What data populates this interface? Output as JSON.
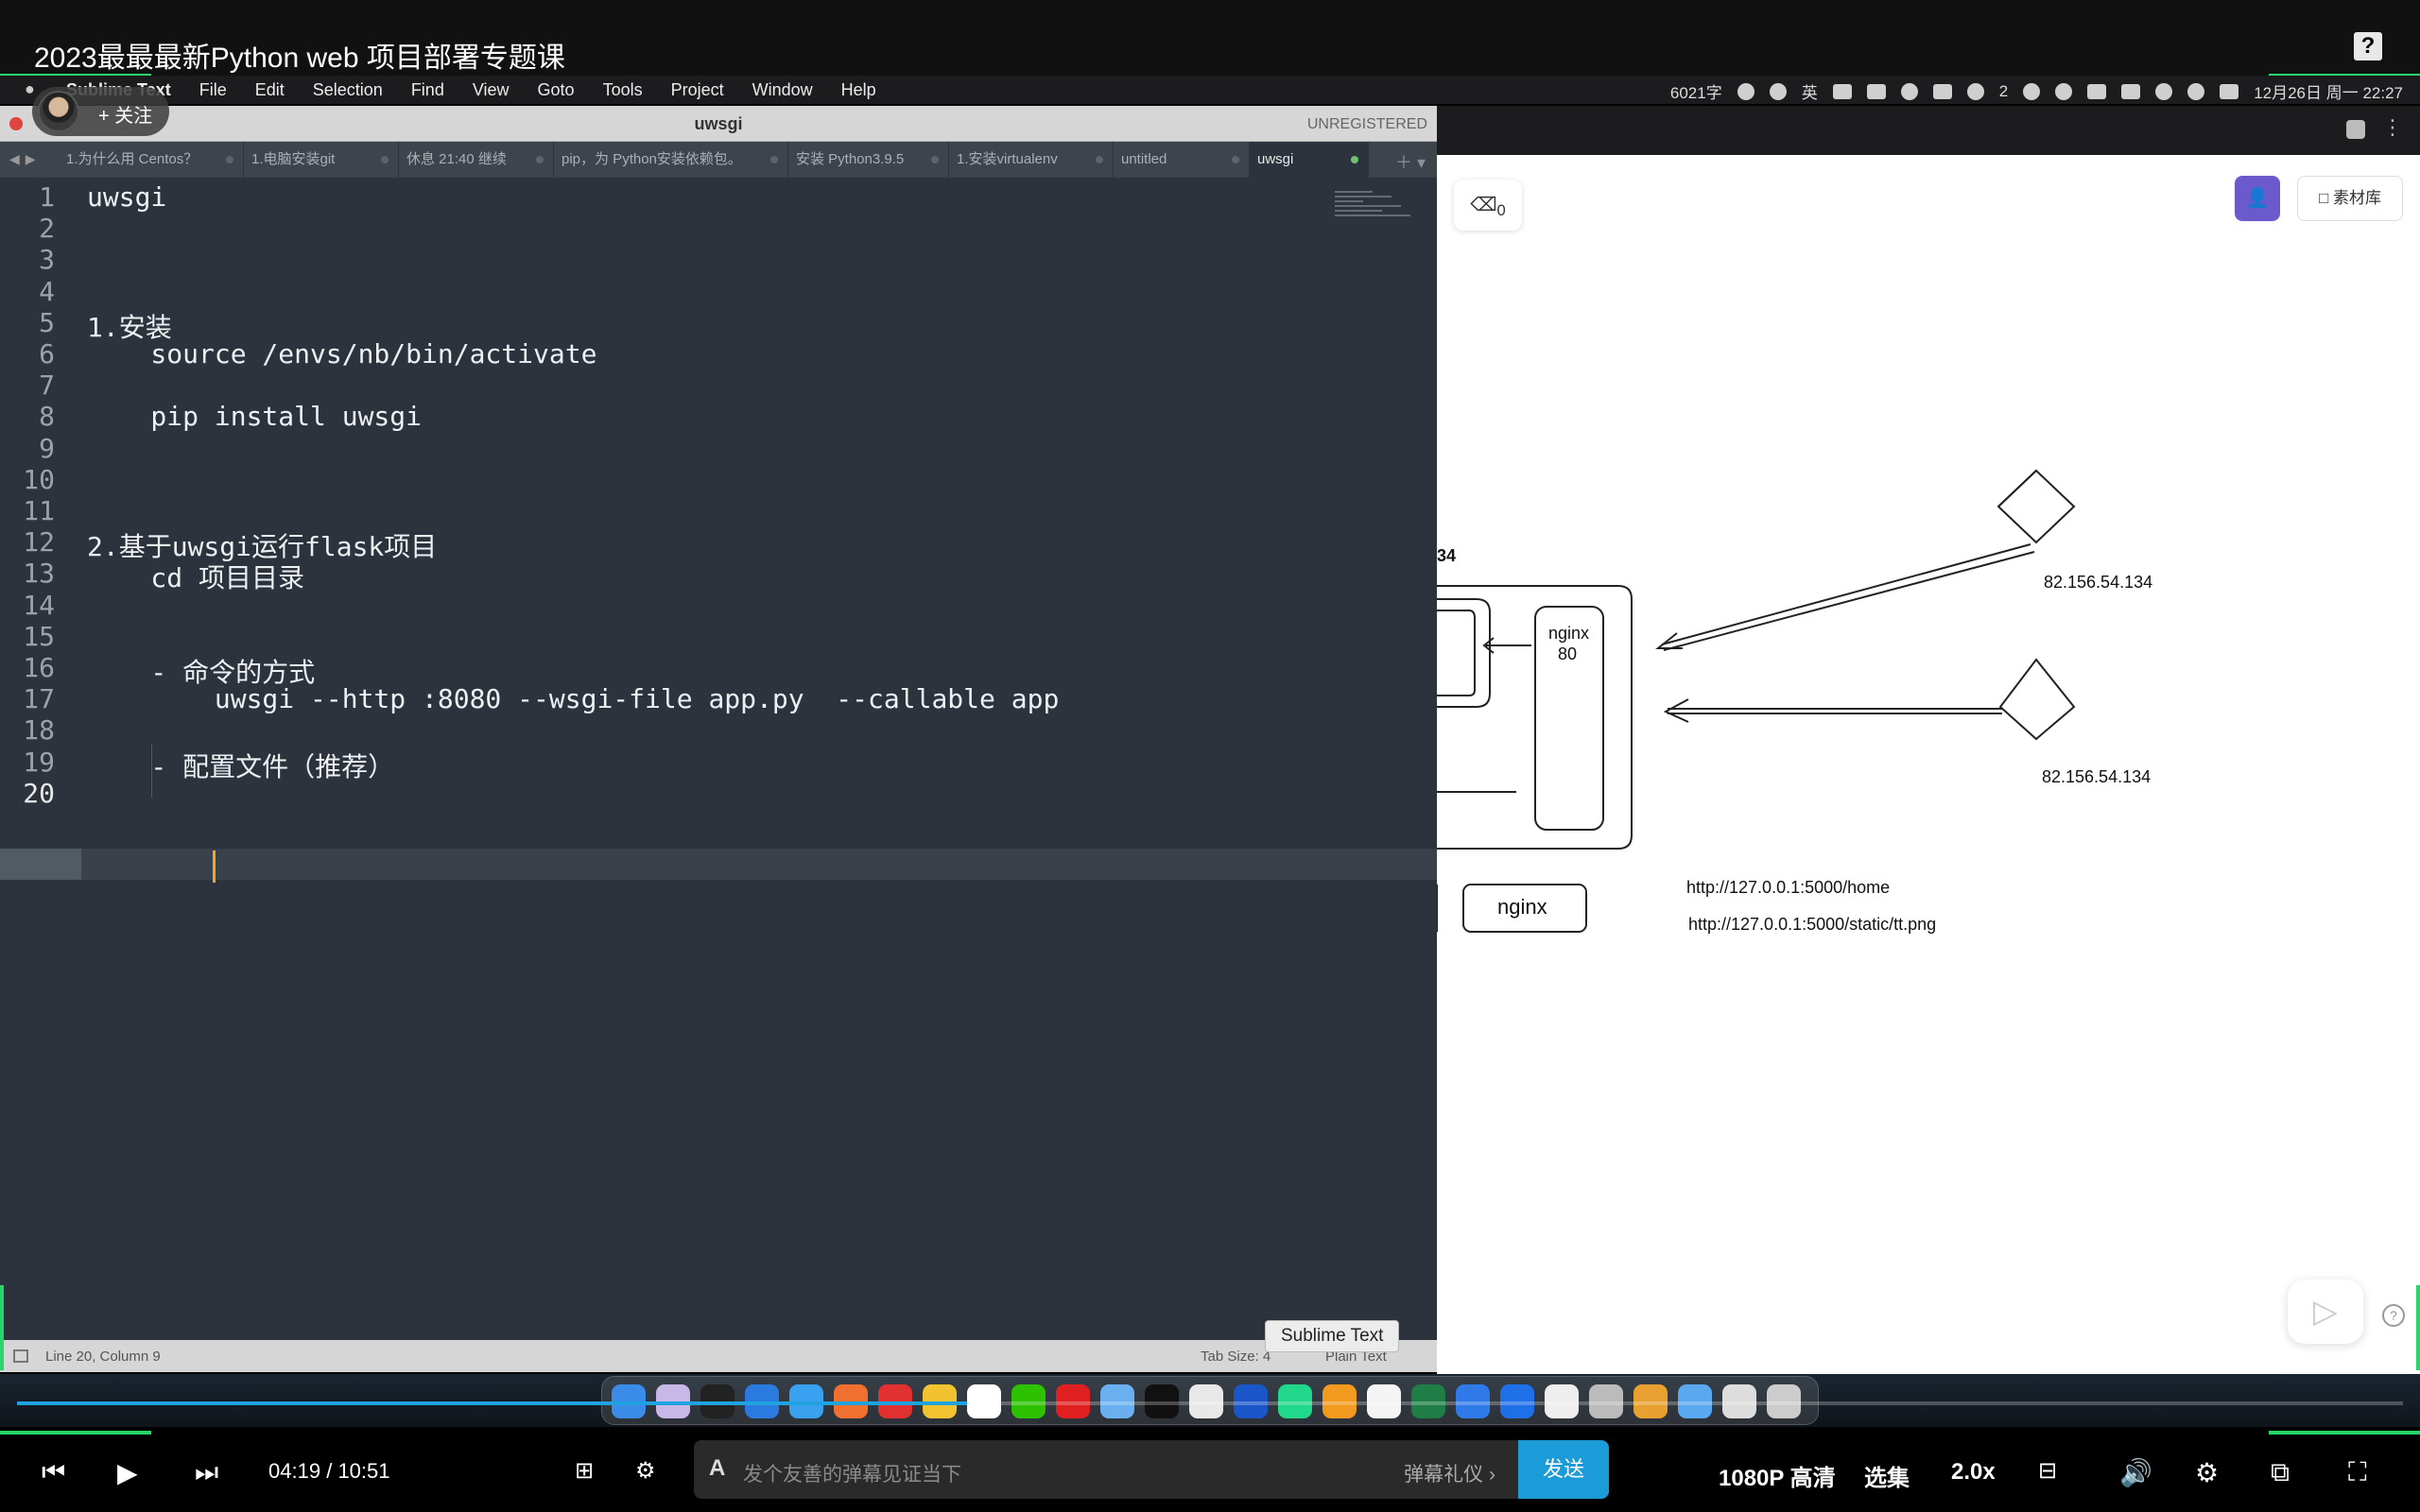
{
  "video": {
    "title": "2023最最最新Python web 项目部署专题课",
    "help_label": "?"
  },
  "streamer": {
    "follow_label": "+ 关注"
  },
  "mac_menubar": {
    "items": [
      "Sublime Text",
      "File",
      "Edit",
      "Selection",
      "Find",
      "View",
      "Goto",
      "Tools",
      "Project",
      "Window",
      "Help"
    ],
    "status": {
      "word_count": "6021字",
      "ime": "英",
      "wechat_count": "2",
      "datetime": "12月26日 周一 22:27"
    }
  },
  "sublime": {
    "window_title": "uwsgi",
    "unregistered": "UNREGISTERED",
    "tabs": [
      {
        "label": "1.为什么用 Centos？",
        "active": false
      },
      {
        "label": "1.电脑安装git",
        "active": false
      },
      {
        "label": "休息 21:40 继续",
        "active": false
      },
      {
        "label": "pip，为 Python安装依赖包。",
        "active": false
      },
      {
        "label": "安装 Python3.9.5",
        "active": false
      },
      {
        "label": "1.安装virtualenv",
        "active": false
      },
      {
        "label": "untitled",
        "active": false
      },
      {
        "label": "uwsgi",
        "active": true
      }
    ],
    "lines": [
      "uwsgi",
      "",
      "",
      "",
      "1.安装",
      "    source /envs/nb/bin/activate",
      "",
      "    pip install uwsgi",
      "",
      "",
      "",
      "2.基于uwsgi运行flask项目",
      "    cd 项目目录",
      "",
      "",
      "    - 命令的方式",
      "        uwsgi --http :8080 --wsgi-file app.py  --callable app",
      "",
      "    - 配置文件（推荐）",
      ""
    ],
    "current_line": 20,
    "status": {
      "position": "Line 20, Column 9",
      "tab_size": "Tab Size: 4",
      "syntax": "Plain Text"
    },
    "tooltip": "Sublime Text"
  },
  "drawing": {
    "eraser_count": "0",
    "material_label": "素材库",
    "partial_label": "34",
    "nginx_box_label": "nginx",
    "nginx_port": "80",
    "nginx_label": "nginx",
    "server1_ip": "82.156.54.134",
    "server2_ip": "82.156.54.134",
    "url1": "http://127.0.0.1:5000/home",
    "url2": "http://127.0.0.1:5000/static/tt.png"
  },
  "player": {
    "current_time": "04:19",
    "separator": "/",
    "total_time": "10:51",
    "progress": 0.398,
    "danmaku_placeholder": "发个友善的弹幕见证当下",
    "danmaku_etiquette": "弹幕礼仪 ›",
    "send_label": "发送",
    "quality": "1080P 高清",
    "episodes": "选集",
    "speed": "2.0x"
  },
  "colors": {
    "accent_green": "#27d66a",
    "progress_blue": "#1fa3e0",
    "editor_bg": "#2c333c",
    "caret": "#f5a623"
  }
}
